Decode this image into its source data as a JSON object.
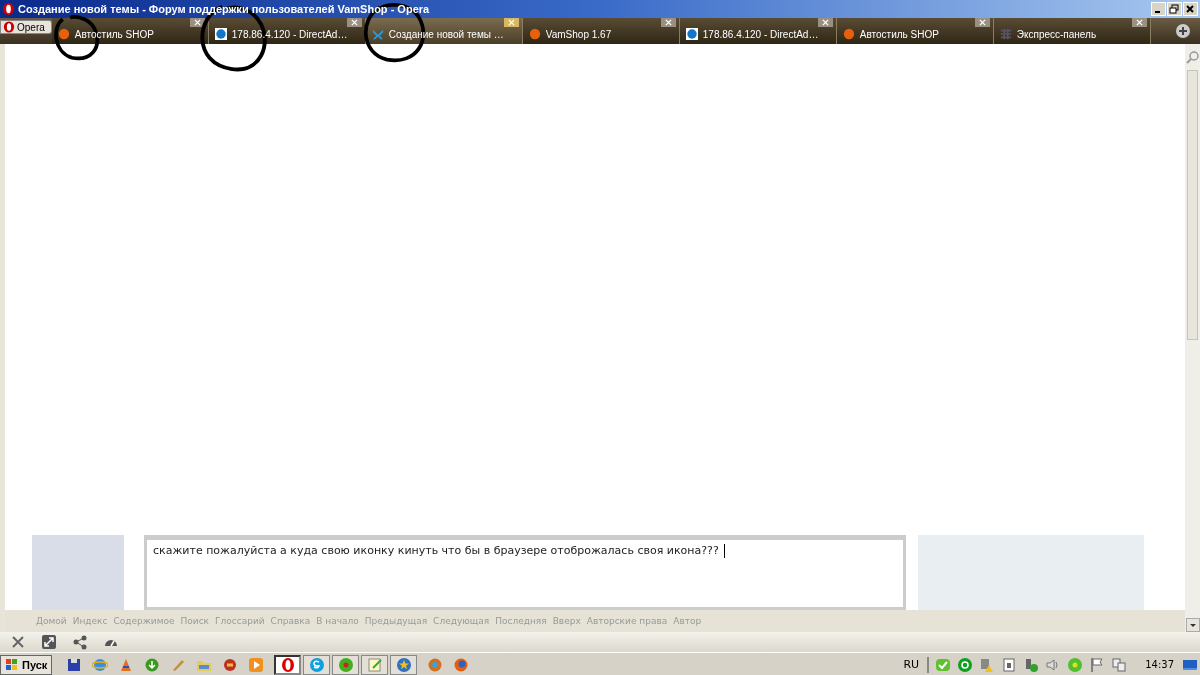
{
  "window": {
    "title": "Создание новой темы - Форум поддержки пользователей VamShop - Opera"
  },
  "menu_button": {
    "label": "Opera"
  },
  "tabs": [
    {
      "label": "Автостиль SHOP",
      "kind": "site",
      "selected": false
    },
    {
      "label": "178.86.4.120 - DirectAd…",
      "kind": "server",
      "selected": false
    },
    {
      "label": "Создание новой темы …",
      "kind": "forum",
      "selected": true
    },
    {
      "label": "VamShop 1.67",
      "kind": "site",
      "selected": false
    },
    {
      "label": "178.86.4.120 - DirectAd…",
      "kind": "server",
      "selected": false
    },
    {
      "label": "Автостиль SHOP",
      "kind": "site",
      "selected": false
    },
    {
      "label": "Экспресс-панель",
      "kind": "dial",
      "selected": false
    }
  ],
  "message": {
    "value": "скажите пожалуйста а куда свою иконку кинуть что бы в браузере отоброжалась своя икона???"
  },
  "nav_links": [
    "Домой",
    "Индекс",
    "Содержимое",
    "Поиск",
    "Глоссарий",
    "Справка",
    "В начало",
    "Предыдущая",
    "Следующая",
    "Последняя",
    "Вверх",
    "Авторские права",
    "Автор"
  ],
  "taskbar": {
    "start": "Пуск",
    "tasks": [
      {
        "kind": "browser",
        "selected": true
      },
      {
        "kind": "phone",
        "selected": false
      },
      {
        "kind": "chat",
        "selected": false
      },
      {
        "kind": "editor",
        "selected": false
      },
      {
        "kind": "favorites",
        "selected": false
      }
    ],
    "language": "RU",
    "clock": "14:37"
  }
}
